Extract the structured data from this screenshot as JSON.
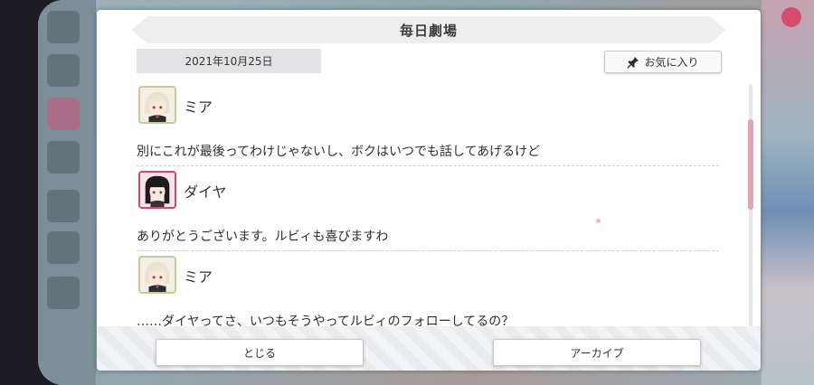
{
  "dialog": {
    "title": "毎日劇場",
    "date": "2021年10月25日",
    "favorite_label": "お気に入り",
    "entries": [
      {
        "speaker": "ミア",
        "text": "別にこれが最後ってわけじゃないし、ボクはいつでも話してあげるけど"
      },
      {
        "speaker": "ダイヤ",
        "text": "ありがとうございます。ルビィも喜びますわ"
      },
      {
        "speaker": "ミア",
        "text": "……ダイヤってさ、いつもそうやってルビィのフォローしてるの？"
      }
    ],
    "close_label": "とじる",
    "archive_label": "アーカイブ"
  },
  "colors": {
    "accent_pink": "#e8a1b0",
    "avatar_red_border": "#d24a6a"
  },
  "icons": [
    "menu-icon",
    "pin-icon",
    "close-icon"
  ]
}
